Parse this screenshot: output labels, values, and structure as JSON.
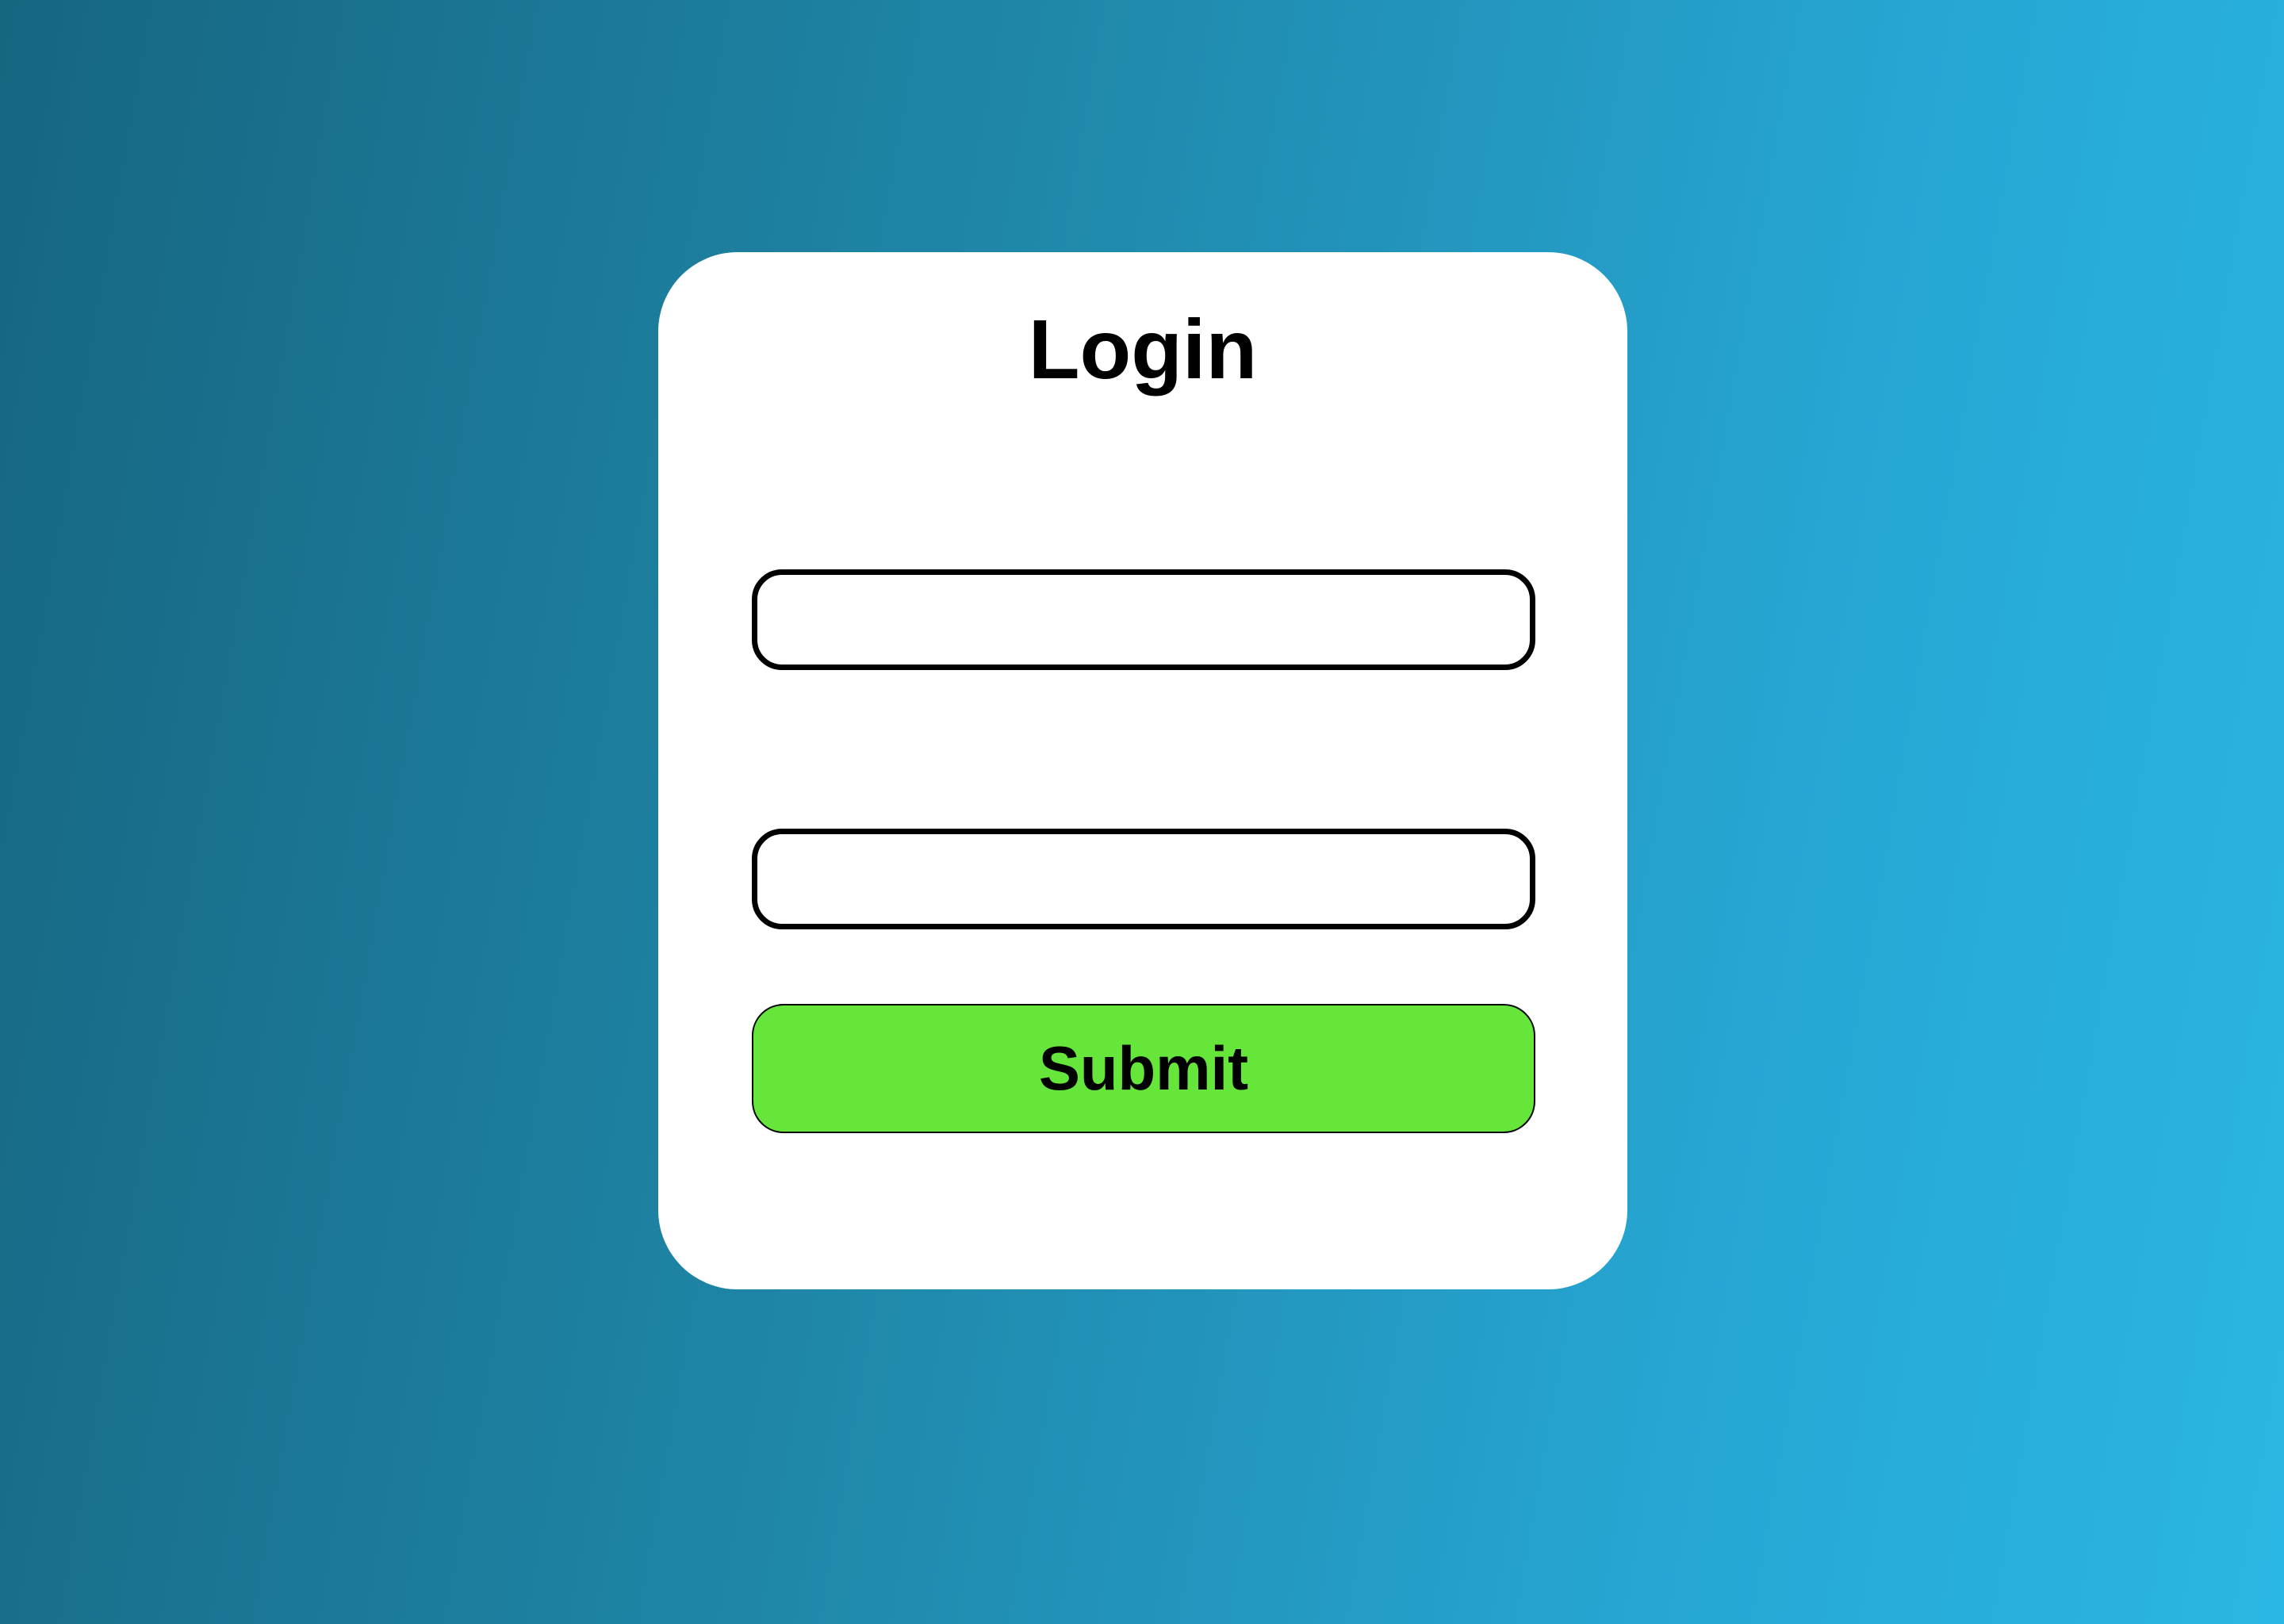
{
  "login": {
    "title": "Login",
    "username": {
      "value": "",
      "placeholder": ""
    },
    "password": {
      "value": "",
      "placeholder": ""
    },
    "submit_label": "Submit"
  },
  "colors": {
    "background_start": "#166680",
    "background_end": "#2ab6e4",
    "card": "#ffffff",
    "submit": "#66e53a"
  }
}
